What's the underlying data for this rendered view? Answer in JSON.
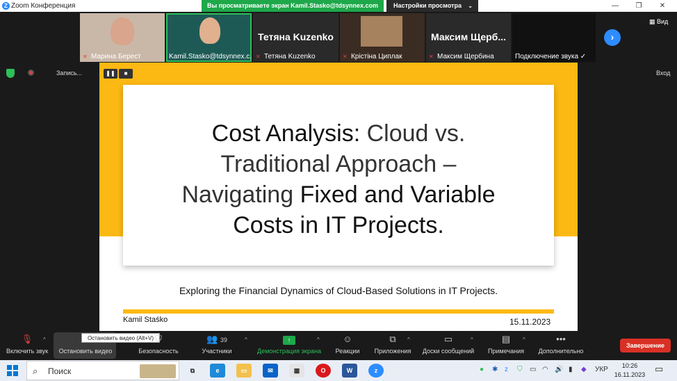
{
  "window": {
    "title": "Zoom Конференция",
    "share_banner": "Вы просматриваете экран Kamil.Stasko@tdsynnex.com",
    "view_options": "Настройки просмотра",
    "view_mode": "Вид"
  },
  "participants": [
    {
      "name": "Марина Берест"
    },
    {
      "name": "Kamil.Stasko@tdsynnex.c..."
    },
    {
      "name": "Тетяна Kuzenko",
      "big_name": "Тетяна Kuzenko"
    },
    {
      "name": "Крістіна Циплак"
    },
    {
      "name": "Максим Щербина",
      "big_name": "Максим Щерб..."
    },
    {
      "name": "Подключение звука ✓"
    }
  ],
  "recording": {
    "label": "Запись..."
  },
  "exit_label": "Вход",
  "slide": {
    "title_line1_bold": "Cost Analysis:",
    "title_line1_light": " Cloud vs.",
    "title_line2_light": "Traditional Approach –",
    "title_line3_light": "Navigating ",
    "title_line3_bold": "Fixed and Variable",
    "title_line4_bold": "Costs in IT Projects.",
    "subtitle": "Exploring the Financial Dynamics of Cloud-Based Solutions in IT Projects.",
    "author": "Kamil Staśko",
    "date": "15.11.2023"
  },
  "toolbar": {
    "mute": "Включить звук",
    "stop_video": "Остановить видео",
    "stop_video_tooltip": "Остановить видео (Alt+V)",
    "security": "Безопасность",
    "participants": "Участники",
    "participants_count": "39",
    "share_screen": "Демонстрация экрана",
    "reactions": "Реакции",
    "apps": "Приложения",
    "whiteboards": "Доски сообщений",
    "notes": "Примечания",
    "more": "Дополнительно",
    "end": "Завершение"
  },
  "taskbar": {
    "search_placeholder": "Поиск",
    "language": "УКР",
    "time": "10:26",
    "date": "16.11.2023"
  },
  "colors": {
    "accent_yellow": "#fdb913",
    "share_green": "#1ea84a",
    "end_red": "#d93025",
    "zoom_blue": "#2d8cff"
  }
}
